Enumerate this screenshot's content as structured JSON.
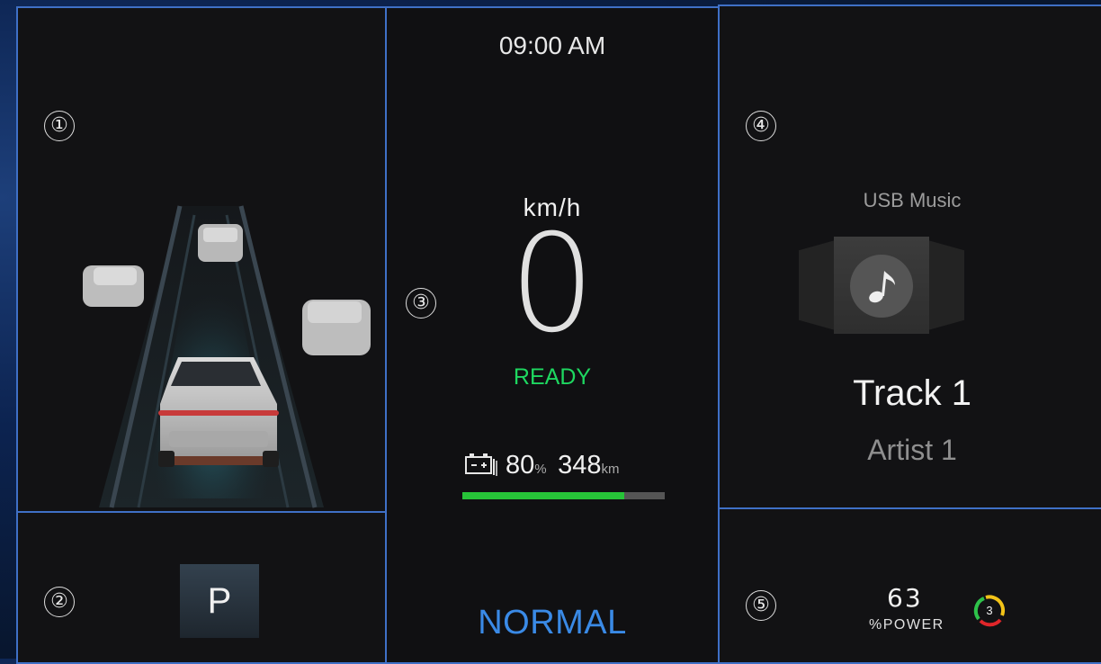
{
  "panels": {
    "adas": {
      "number": "①"
    },
    "gear": {
      "number": "②",
      "gear": "P"
    },
    "cluster": {
      "number": "③",
      "time": "09:00 AM",
      "speed_unit": "km/h",
      "speed": "0",
      "status": "READY",
      "battery_percent": "80",
      "battery_percent_unit": "%",
      "range": "348",
      "range_unit": "km",
      "battery_level": 0.8,
      "drive_mode": "NORMAL",
      "colors": {
        "ready": "#1ed760",
        "mode": "#3a8ae6",
        "battery_bar": "#27c438"
      }
    },
    "media": {
      "number": "④",
      "source": "USB Music",
      "album_icon": "music-note-icon",
      "track": "Track 1",
      "artist": "Artist 1"
    },
    "power": {
      "number": "⑤",
      "value": "63",
      "label": "%POWER",
      "level": "3"
    }
  },
  "accent_border": "#3f70c6"
}
